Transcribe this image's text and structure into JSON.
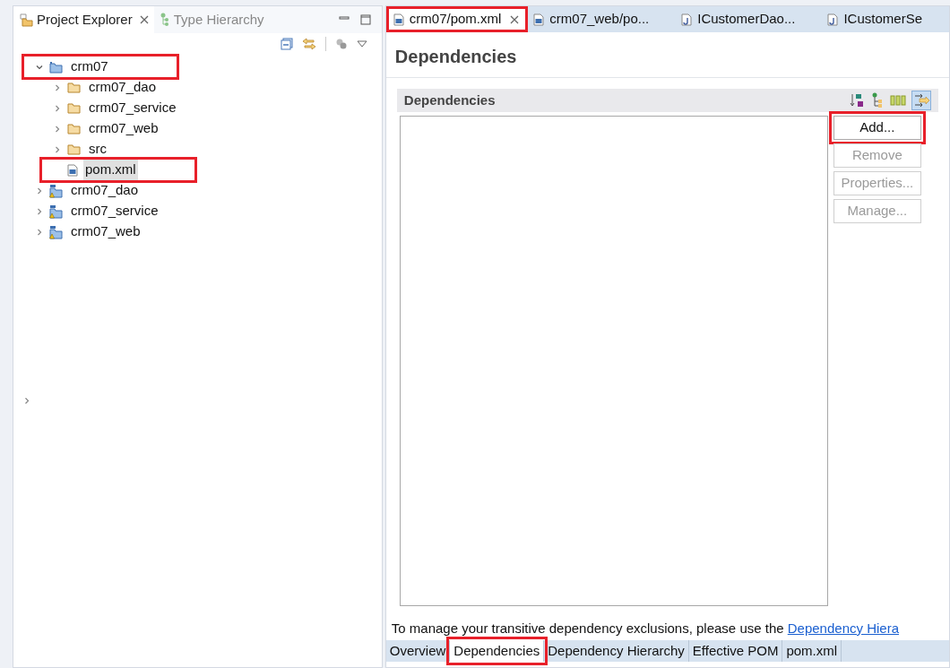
{
  "left_panel": {
    "tabs": [
      {
        "label": "Project Explorer",
        "selected": true,
        "closable": true
      },
      {
        "label": "Type Hierarchy",
        "selected": false,
        "closable": false
      }
    ],
    "tree": [
      {
        "label": "crm07",
        "kind": "project",
        "expanded": true,
        "highlighted": true,
        "children": [
          {
            "label": "crm07_dao",
            "kind": "folder",
            "expanded": false,
            "highlighted": false
          },
          {
            "label": "crm07_service",
            "kind": "folder",
            "expanded": false,
            "highlighted": false
          },
          {
            "label": "crm07_web",
            "kind": "folder",
            "expanded": false,
            "highlighted": false
          },
          {
            "label": "src",
            "kind": "folder",
            "expanded": false,
            "highlighted": false
          },
          {
            "label": "pom.xml",
            "kind": "file",
            "highlighted": true,
            "selected": true
          }
        ]
      },
      {
        "label": "crm07_dao",
        "kind": "module",
        "expanded": false,
        "highlighted": false
      },
      {
        "label": "crm07_service",
        "kind": "module",
        "expanded": false,
        "highlighted": false
      },
      {
        "label": "crm07_web",
        "kind": "module",
        "expanded": false,
        "highlighted": false
      }
    ]
  },
  "editor": {
    "tabs": [
      {
        "label": "crm07/pom.xml",
        "kind": "maven",
        "selected": true,
        "highlighted": true
      },
      {
        "label": "crm07_web/po...",
        "kind": "maven",
        "selected": false,
        "highlighted": false
      },
      {
        "label": "ICustomerDao...",
        "kind": "java",
        "selected": false,
        "highlighted": false
      },
      {
        "label": "ICustomerSe",
        "kind": "java",
        "selected": false,
        "highlighted": false
      }
    ],
    "page_title": "Dependencies",
    "section": {
      "title": "Dependencies",
      "buttons": [
        {
          "label": "Add...",
          "disabled": false,
          "highlighted": true
        },
        {
          "label": "Remove",
          "disabled": true,
          "highlighted": false
        },
        {
          "label": "Properties...",
          "disabled": true,
          "highlighted": false
        },
        {
          "label": "Manage...",
          "disabled": true,
          "highlighted": false
        }
      ]
    },
    "hint": {
      "text": "To manage your transitive dependency exclusions, please use the ",
      "link": "Dependency Hiera"
    },
    "bottom_tabs": [
      {
        "label": "Overview",
        "selected": false,
        "highlighted": false
      },
      {
        "label": "Dependencies",
        "selected": true,
        "highlighted": true
      },
      {
        "label": "Dependency Hierarchy",
        "selected": false,
        "highlighted": false
      },
      {
        "label": "Effective POM",
        "selected": false,
        "highlighted": false
      },
      {
        "label": "pom.xml",
        "selected": false,
        "highlighted": false
      }
    ]
  }
}
